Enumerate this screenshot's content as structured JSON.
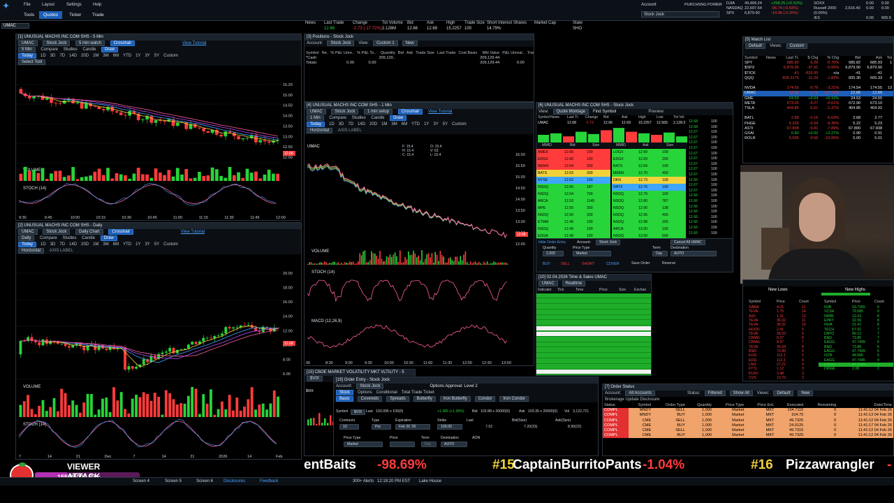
{
  "top": {
    "menu": [
      "File",
      "Layout",
      "Settings",
      "Help"
    ],
    "tabs": [
      "Tools",
      "Quotes",
      "Ticker",
      "Trade"
    ],
    "active_tab": "Quotes",
    "symbol_box": "UMAC",
    "account_label": "Account",
    "account_value": "Stock Jock",
    "purchasing_power_label": "PURCHSNG POWER",
    "indices": [
      {
        "name": "DJIA",
        "value": "49,499.24",
        "chg": "+258.25 (+0.52%)",
        "color": "#27d43a"
      },
      {
        "name": "NASDAQ",
        "value": "22,697.64",
        "chg": "-96.74 (-0.43%)",
        "color": "#ff3b3b"
      },
      {
        "name": "SPX",
        "value": "6,879.90",
        "chg": "-14.08 (-0.20%)",
        "color": "#ff3b3b"
      }
    ],
    "indices2": [
      {
        "name": "SOXX",
        "value": "",
        "chg": "0.00"
      },
      {
        "name": "Russell 2000",
        "value": "2,616.40",
        "chg": "0.00"
      },
      {
        "name": "/ES",
        "value": "",
        "chg": "0.00"
      }
    ],
    "fut_values": [
      "0.00",
      "0.00 (0.00%)",
      "665.5"
    ]
  },
  "header_quote": {
    "labels": [
      "News",
      "Last Trade",
      "Change",
      "Tot Volume",
      "Bid",
      "Ask",
      "High",
      "Trade Size",
      "Short Interest",
      "Shares",
      "Market Cap",
      "State"
    ],
    "values": [
      "",
      "12.68",
      "-2.73 (-17.72%)",
      "2.128M",
      "12.66",
      "12.69",
      "15.2257",
      "100",
      "14.79%",
      "",
      "",
      "SHO"
    ]
  },
  "chart1": {
    "title": "[1] UNUSUAL MACHS INC COM SHS - 5 Min",
    "symbol": "UMAC",
    "account": "Stock Jock",
    "watch": "5 min watch",
    "crosshair": "Crosshair",
    "tutorial": "View Tutorial",
    "interval": "5 Min",
    "compare": "Compare",
    "studies": "Studies",
    "candle": "Candle",
    "draw": "Draw",
    "ranges": [
      "Today",
      "1D",
      "3D",
      "7D",
      "14D",
      "20D",
      "1M",
      "3M",
      "6M",
      "YTD",
      "1Y",
      "3Y",
      "5Y",
      "Custom"
    ],
    "select_tool": "Select Tool",
    "price_info": "2.73 (-17.72%)",
    "price_label": "12.68",
    "xlabels": [
      "9:30",
      "9:45",
      "10:00",
      "10:15",
      "10:30",
      "10:45",
      "11:00",
      "11:15",
      "11:30",
      "11:45",
      "12:00"
    ],
    "ylabels": [
      "15.20",
      "15.00",
      "14.50",
      "14.00",
      "13.50",
      "13.00",
      "12.50",
      "12.00"
    ],
    "volume": "VOLUME",
    "stoch": "STOCH (14)"
  },
  "chart2": {
    "title": "[2] UNUSUAL MACHS INC COM SHS - Daily",
    "interval": "Daily",
    "setup": "Daily Chart",
    "horizontal": "Horizontal",
    "axis_label": "AXIS LABEL",
    "xlabels": [
      "7",
      "14",
      "21",
      "Dec",
      "7",
      "14",
      "21",
      "2026",
      "14",
      "Feb"
    ],
    "ylabels": [
      "20.00",
      "18.00",
      "16.00",
      "14.00",
      "12.00",
      "10.00",
      "8.00",
      "6.00"
    ],
    "volume": "VOLUME",
    "stoch": "STOCH (14)"
  },
  "chart3": {
    "title": "[4] UNUSUAL MACHS INC COM SHS - 1 Min",
    "interval": "1 Min",
    "setup": "1 min setup",
    "xlabels": [
      "00",
      "8:30",
      "9:00",
      "9:30",
      "10:00",
      "10:30",
      "11:00",
      "11:30",
      "12:00",
      "12:30",
      "13:00"
    ],
    "ylabels": [
      "16.00",
      "15.50",
      "15.00",
      "14.50",
      "14.00",
      "13.50",
      "13.00",
      "12.50",
      "12.00"
    ],
    "volume": "VOLUME",
    "stoch": "STOCH (14)",
    "macd": "MACD (12,26,9)",
    "info": [
      "F: 15.4",
      "O: 15.4",
      "H: 15.4",
      "V: 63",
      "C: 15.4",
      "L: 15.4"
    ]
  },
  "positions": {
    "title": "[3] Positions - Stock Jock",
    "account": "Stock Jock",
    "view": "Custom 1",
    "new": "New",
    "cols": [
      "Symbol",
      "Ne.",
      "% P&L Unre..",
      "% P&L To..",
      "Quantity",
      "Bid",
      "Ask",
      "Trade Size",
      "Last Trade",
      "Cost Basis",
      "Mkt Value",
      "P&L Unreal..",
      "Trade",
      "Notes"
    ],
    "rows": [
      [
        "*Cash",
        "",
        "",
        "",
        "209,129..",
        "",
        "",
        "",
        "",
        "",
        "209,129.44",
        "",
        "",
        ""
      ],
      [
        "Totals:",
        "",
        "0.00",
        "0.00",
        "",
        "",
        "",
        "",
        "",
        "",
        "209,129.44",
        "0.00",
        "",
        ""
      ]
    ]
  },
  "level2": {
    "title": "[6] UNUSUAL MACHS INC COM SHS - Stock Jock",
    "view": "Quote Montage",
    "find": "Find Symbol",
    "preview": "Preview:",
    "cols": [
      "Symbol",
      "News",
      "Last Tr.",
      "Change",
      "Bid",
      "Ask",
      "High",
      "Low",
      "Tot Vol"
    ],
    "quote": [
      "UMAC",
      "",
      "12.68",
      "-2.73",
      "12.66",
      "12.69",
      "15.2257",
      "12.565",
      "2,128.3"
    ],
    "book_cols": [
      "MMID",
      "Bid",
      "Size",
      "MMID",
      "Ask",
      "Size"
    ],
    "bids": [
      [
        "AMEX",
        "12.66",
        "100"
      ],
      [
        "EDGX",
        "12.66",
        "100"
      ],
      [
        "MEMX",
        "12.64",
        "300"
      ],
      [
        "BATS",
        "12.63",
        "200"
      ],
      [
        "NYSE",
        "12.62",
        "100"
      ],
      [
        "NSDQ",
        "12.60",
        "187"
      ],
      [
        "NSDQ",
        "12.54",
        "700"
      ],
      [
        "ARCA",
        "12.53",
        "1145"
      ],
      [
        "MPE",
        "12.50",
        "300"
      ],
      [
        "NSDQ",
        "12.50",
        "200"
      ],
      [
        "ETMM",
        "12.49",
        "100"
      ],
      [
        "NSDQ",
        "12.49",
        "100"
      ],
      [
        "EDGA",
        "12.49",
        "100"
      ]
    ],
    "asks": [
      [
        "LOGX",
        "12.69",
        "100"
      ],
      [
        "EDGX",
        "12.69",
        "200"
      ],
      [
        "BATS",
        "12.69",
        "100"
      ],
      [
        "MEMX",
        "12.70",
        "400"
      ],
      [
        "DKN",
        "12.73",
        "100"
      ],
      [
        "NATX",
        "12.76",
        "100"
      ],
      [
        "NSDQ",
        "12.79",
        "100"
      ],
      [
        "NSDQ",
        "12.80",
        "787"
      ],
      [
        "NSDQ",
        "12.90",
        "138"
      ],
      [
        "NSDQ",
        "12.95",
        "400"
      ],
      [
        "NSDQ",
        "12.98",
        "200"
      ],
      [
        "ARCA",
        "13.00",
        "100"
      ],
      [
        "NSDQ",
        "13.00",
        "500"
      ]
    ],
    "prices": [
      "12.68",
      "12.68",
      "12.67",
      "12.67",
      "12.67",
      "12.67",
      "12.67",
      "12.67",
      "12.67",
      "12.67",
      "12.67",
      "12.66",
      "12.67",
      "12.67",
      "12.66",
      "12.66",
      "12.66",
      "12.66",
      "12.66",
      "12.66",
      "12.66",
      "12.66"
    ],
    "order": {
      "hide": "Hide Order Entry",
      "account": "Stock Jock",
      "quantity_label": "Quantity",
      "quantity": "2,000",
      "price_type_label": "Price Type",
      "price_type": "Market",
      "term_label": "Term",
      "term": "Day",
      "destination_label": "Destination",
      "destination": "AUTO",
      "cancel_all": "Cancel All UMAC",
      "buy": "BUY",
      "sell": "SELL",
      "short": "SHORT",
      "cover": "COVER",
      "save": "Save Order",
      "reserve": "Reserve"
    }
  },
  "timesales": {
    "title": "[10] 02.04.2026 Time & Sales UMAC",
    "symbol": "UMAC",
    "mode": "Realtime",
    "cols": [
      "Indicator",
      "Tick",
      "Time",
      "Price",
      "Size",
      "Exchan"
    ]
  },
  "watchlist": {
    "title": "[5] Watch List",
    "cols": [
      "Symbol",
      "News",
      "Last Tr.",
      "$ Chg",
      "% Chg",
      "Bid",
      "Ask",
      "Tot"
    ],
    "view": "Custom",
    "list": "Default",
    "rows": [
      [
        "SPY",
        "",
        "685.90",
        "-5.26",
        "-0.76%",
        "685.82",
        "685.93",
        "1"
      ],
      [
        "$SPX",
        "",
        "6,879.90",
        "-37.91",
        "-0.55%",
        "6,879.90",
        "6,879.90",
        ""
      ],
      [
        "$TICK",
        "",
        "-41",
        "-633.00",
        "n/a",
        "-41",
        "-41",
        ""
      ],
      [
        "QQQ",
        "",
        "605.3175",
        "-11.29",
        "-1.83%",
        "605.30",
        "605.33",
        "4"
      ],
      [
        "",
        "",
        "",
        "",
        "",
        "",
        "",
        ""
      ],
      [
        "NVDA",
        "",
        "174.55",
        "-5.79",
        "-3.21%",
        "174.54",
        "174.55",
        "13"
      ],
      [
        "UMAC",
        "",
        "12.68",
        "-2.73",
        "-17.72%",
        "12.66",
        "12.69",
        ""
      ],
      [
        "GME",
        "",
        "24.53",
        "+0.04",
        "+0.16%",
        "24.53",
        "24.55",
        ""
      ],
      [
        "META",
        "",
        "673.05",
        "-4.27",
        "-0.61%",
        "672.90",
        "673.10",
        ""
      ],
      [
        "TSLA",
        "",
        "404.86",
        "-5.61",
        "-1.37%",
        "404.85",
        "404.92",
        ""
      ],
      [
        "",
        "",
        "",
        "",
        "",
        "",
        "",
        ""
      ],
      [
        "BATL",
        "",
        "2.68",
        "-0.16",
        "-5.63%",
        "2.68",
        "2.77",
        ""
      ],
      [
        "PHGE",
        "",
        "5.226",
        "-0.54",
        "-9.35%",
        "5.22",
        "5.23",
        ""
      ],
      [
        "ASTI",
        "",
        "67.838",
        "-5.81",
        "-7.89%",
        "67.800",
        "67.838",
        ""
      ],
      [
        "GXAI",
        "",
        "0.90",
        "+0.02",
        "+2.27%",
        "0.90",
        "0.91",
        ""
      ],
      [
        "ROLR",
        "",
        "5.005",
        "-0.56",
        "-10.05%",
        "5.00",
        "5.01",
        ""
      ]
    ]
  },
  "highs_lows": {
    "lows_title": "New Lows",
    "highs_title": "New Highs",
    "cols": [
      "Symbol",
      "Price",
      "Count"
    ],
    "lows": [
      [
        "SAMA",
        "4.01",
        "11"
      ],
      [
        "TEVA",
        "1.75",
        "14"
      ],
      [
        "AIXI",
        "1.31",
        "12"
      ],
      [
        "TEVA",
        "36.02",
        "11"
      ],
      [
        "TEVA",
        "36.02",
        "10"
      ],
      [
        "HOOD",
        "2.41",
        "9"
      ],
      [
        "TEVA",
        "36.03",
        "9"
      ],
      [
        "CRMG",
        "8.37",
        "8"
      ],
      [
        "CRMG",
        "8.37",
        "7"
      ],
      [
        "TEVA",
        "36.04",
        "8"
      ],
      [
        "BND",
        "73.85",
        "6"
      ],
      [
        "EOG",
        "112.1",
        "5"
      ],
      [
        "EOG",
        "112.2",
        "4"
      ],
      [
        "LNG",
        "27.21",
        "4"
      ],
      [
        "FTTL",
        "1.12",
        "3"
      ],
      [
        "PLRX",
        "3.48",
        "3"
      ],
      [
        "CVS",
        "13.70",
        "2"
      ]
    ],
    "highs": [
      [
        "IGIB",
        "53.7355",
        "6"
      ],
      [
        "VCSH",
        "79.585",
        "9"
      ],
      [
        "NWBI",
        "12.63",
        "8"
      ],
      [
        "EPRT",
        "32.59",
        "8"
      ],
      [
        "INVA",
        "21.47",
        "8"
      ],
      [
        "TECH",
        "67.91",
        "7"
      ],
      [
        "DAYO",
        "89.12",
        "7"
      ],
      [
        "BND",
        "73.85",
        "7"
      ],
      [
        "EAGG",
        "47.7499",
        "6"
      ],
      [
        "BND",
        "73.88",
        "6"
      ],
      [
        "EAGG",
        "47.7499",
        "5"
      ],
      [
        "ISTB",
        "48.585",
        "5"
      ],
      [
        "EAGG",
        "47.7445",
        "4"
      ],
      [
        "EAGG",
        "47.7445",
        "3"
      ],
      [
        "DRMA",
        "2.08",
        "2"
      ]
    ]
  },
  "vix": {
    "title": "[15] CBOE MARKET VOLATILITY MKT VLTILITY - 5",
    "symbol": "$VIX"
  },
  "order_entry": {
    "title": "[19] Order Entry - Stock Jock",
    "account": "Stock Jock",
    "approval": "Options Approval: Level 2",
    "tabs": [
      "Stock",
      "Options",
      "Conditional",
      "Total Trade Ticket"
    ],
    "subtabs": [
      "Basic",
      "Covereds",
      "Spreads",
      "Butterfly",
      "Iron Butterfly",
      "Condor",
      "Iron Condor"
    ],
    "symbol_label": "Symbol",
    "symbol": "$VIX",
    "last": "103.095 x 100(0)",
    "chg": "+1.385 (+1.36%)",
    "bid": "102.88 x 20000(0)",
    "ask": "103.35 x 20000(0)",
    "vol": "3,122,721",
    "contracts_label": "Contracts",
    "contracts": "10",
    "type_label": "Type",
    "type": "Put",
    "exp_label": "Expiration",
    "exp": "Feb 26 '26",
    "strike_label": "Strike",
    "strike": "100.00",
    "last_label": "Last",
    "last_val": "7.52",
    "bidsize_label": "Bid(Size)",
    "bidsize": "7.20(33)",
    "asksize_label": "Ask(Size)",
    "asksize": "8.90(22)",
    "pricetype_label": "Price Type",
    "pricetype": "Market",
    "price_label": "Price",
    "term_label": "Term",
    "term": "Day",
    "dest_label": "Destination",
    "dest": "AUTO",
    "aon": "AON"
  },
  "order_status": {
    "title": "[7] Order Status",
    "account": "All Accounts",
    "status": "Filtered",
    "show": "Show All",
    "views": "Default",
    "new": "New",
    "disclosure": "Brokerage Update Disclosure",
    "cols": [
      "Status",
      "Symbol",
      "Order Type",
      "Quantity",
      "Price Type",
      "Price Ent.",
      "Executed",
      "Remaining",
      "Date/Time"
    ],
    "rows": [
      [
        "COMPL",
        "MNDY",
        "SELL",
        "1,000",
        "Market",
        "MKT",
        "104.7115",
        "0",
        "11:41:12 04 Feb 26"
      ],
      [
        "COMPL",
        "MNDY",
        "BUY",
        "1,000",
        "Market",
        "MKT",
        "104.75",
        "0",
        "11:41:13 04 Feb 26"
      ],
      [
        "COMPL",
        "CME",
        "SELL",
        "1,000",
        "Market",
        "MKT",
        "49.7325",
        "0",
        "11:41:12 04 Feb 26"
      ],
      [
        "COMPL",
        "CME",
        "BUY",
        "1,000",
        "Market",
        "MKT",
        "24.0125",
        "0",
        "11:41:17 04 Feb 26"
      ],
      [
        "COMPL",
        "CME",
        "SELL",
        "1,000",
        "Market",
        "MKT",
        "49.7315",
        "0",
        "11:41:12 04 Feb 26"
      ],
      [
        "COMPL",
        "CME",
        "BUY",
        "1,000",
        "Market",
        "MKT",
        "49.7325",
        "0",
        "11:41:12 04 Feb 26"
      ]
    ]
  },
  "overlay": {
    "viewer_attack": "VIEWER ATTACK",
    "bits": "1550/5000 Bits",
    "bits_progress": 0.31
  },
  "ticker": [
    {
      "text": "entBaits",
      "color": "#ffffff"
    },
    {
      "text": "-98.69%",
      "color": "#ff3b3b"
    },
    {
      "text": "#15",
      "color": "#f2d23a"
    },
    {
      "text": "CaptainBurritoPants",
      "color": "#ffffff"
    },
    {
      "text": "-1.04%",
      "color": "#ff3b3b"
    },
    {
      "text": "#16",
      "color": "#f2d23a"
    },
    {
      "text": "Pizzawrangler",
      "color": "#ffffff"
    },
    {
      "text": "-",
      "color": "#ff3b3b"
    }
  ],
  "bottombar": {
    "screens": [
      "Screen 4",
      "Screen 5",
      "Screen 6",
      "Disclosures",
      "Feedback"
    ],
    "alerts": "300+ Alerts",
    "time": "12:19:20 PM EST",
    "location": "Lake House"
  },
  "colors": {
    "accent": "#1d5fb8",
    "up": "#27d43a",
    "down": "#ff3b3b",
    "bg": "#000000"
  }
}
